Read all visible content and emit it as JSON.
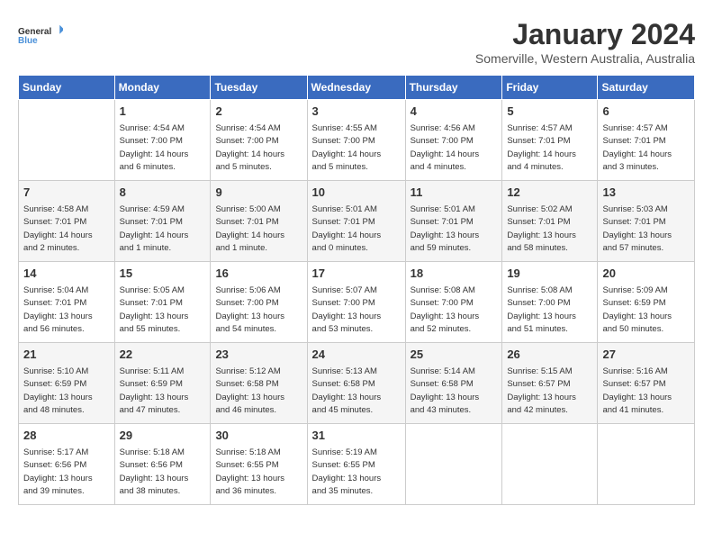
{
  "logo": {
    "line1": "General",
    "line2": "Blue"
  },
  "title": "January 2024",
  "subtitle": "Somerville, Western Australia, Australia",
  "headers": [
    "Sunday",
    "Monday",
    "Tuesday",
    "Wednesday",
    "Thursday",
    "Friday",
    "Saturday"
  ],
  "weeks": [
    [
      {
        "day": "",
        "info": ""
      },
      {
        "day": "1",
        "info": "Sunrise: 4:54 AM\nSunset: 7:00 PM\nDaylight: 14 hours\nand 6 minutes."
      },
      {
        "day": "2",
        "info": "Sunrise: 4:54 AM\nSunset: 7:00 PM\nDaylight: 14 hours\nand 5 minutes."
      },
      {
        "day": "3",
        "info": "Sunrise: 4:55 AM\nSunset: 7:00 PM\nDaylight: 14 hours\nand 5 minutes."
      },
      {
        "day": "4",
        "info": "Sunrise: 4:56 AM\nSunset: 7:00 PM\nDaylight: 14 hours\nand 4 minutes."
      },
      {
        "day": "5",
        "info": "Sunrise: 4:57 AM\nSunset: 7:01 PM\nDaylight: 14 hours\nand 4 minutes."
      },
      {
        "day": "6",
        "info": "Sunrise: 4:57 AM\nSunset: 7:01 PM\nDaylight: 14 hours\nand 3 minutes."
      }
    ],
    [
      {
        "day": "7",
        "info": "Sunrise: 4:58 AM\nSunset: 7:01 PM\nDaylight: 14 hours\nand 2 minutes."
      },
      {
        "day": "8",
        "info": "Sunrise: 4:59 AM\nSunset: 7:01 PM\nDaylight: 14 hours\nand 1 minute."
      },
      {
        "day": "9",
        "info": "Sunrise: 5:00 AM\nSunset: 7:01 PM\nDaylight: 14 hours\nand 1 minute."
      },
      {
        "day": "10",
        "info": "Sunrise: 5:01 AM\nSunset: 7:01 PM\nDaylight: 14 hours\nand 0 minutes."
      },
      {
        "day": "11",
        "info": "Sunrise: 5:01 AM\nSunset: 7:01 PM\nDaylight: 13 hours\nand 59 minutes."
      },
      {
        "day": "12",
        "info": "Sunrise: 5:02 AM\nSunset: 7:01 PM\nDaylight: 13 hours\nand 58 minutes."
      },
      {
        "day": "13",
        "info": "Sunrise: 5:03 AM\nSunset: 7:01 PM\nDaylight: 13 hours\nand 57 minutes."
      }
    ],
    [
      {
        "day": "14",
        "info": "Sunrise: 5:04 AM\nSunset: 7:01 PM\nDaylight: 13 hours\nand 56 minutes."
      },
      {
        "day": "15",
        "info": "Sunrise: 5:05 AM\nSunset: 7:01 PM\nDaylight: 13 hours\nand 55 minutes."
      },
      {
        "day": "16",
        "info": "Sunrise: 5:06 AM\nSunset: 7:00 PM\nDaylight: 13 hours\nand 54 minutes."
      },
      {
        "day": "17",
        "info": "Sunrise: 5:07 AM\nSunset: 7:00 PM\nDaylight: 13 hours\nand 53 minutes."
      },
      {
        "day": "18",
        "info": "Sunrise: 5:08 AM\nSunset: 7:00 PM\nDaylight: 13 hours\nand 52 minutes."
      },
      {
        "day": "19",
        "info": "Sunrise: 5:08 AM\nSunset: 7:00 PM\nDaylight: 13 hours\nand 51 minutes."
      },
      {
        "day": "20",
        "info": "Sunrise: 5:09 AM\nSunset: 6:59 PM\nDaylight: 13 hours\nand 50 minutes."
      }
    ],
    [
      {
        "day": "21",
        "info": "Sunrise: 5:10 AM\nSunset: 6:59 PM\nDaylight: 13 hours\nand 48 minutes."
      },
      {
        "day": "22",
        "info": "Sunrise: 5:11 AM\nSunset: 6:59 PM\nDaylight: 13 hours\nand 47 minutes."
      },
      {
        "day": "23",
        "info": "Sunrise: 5:12 AM\nSunset: 6:58 PM\nDaylight: 13 hours\nand 46 minutes."
      },
      {
        "day": "24",
        "info": "Sunrise: 5:13 AM\nSunset: 6:58 PM\nDaylight: 13 hours\nand 45 minutes."
      },
      {
        "day": "25",
        "info": "Sunrise: 5:14 AM\nSunset: 6:58 PM\nDaylight: 13 hours\nand 43 minutes."
      },
      {
        "day": "26",
        "info": "Sunrise: 5:15 AM\nSunset: 6:57 PM\nDaylight: 13 hours\nand 42 minutes."
      },
      {
        "day": "27",
        "info": "Sunrise: 5:16 AM\nSunset: 6:57 PM\nDaylight: 13 hours\nand 41 minutes."
      }
    ],
    [
      {
        "day": "28",
        "info": "Sunrise: 5:17 AM\nSunset: 6:56 PM\nDaylight: 13 hours\nand 39 minutes."
      },
      {
        "day": "29",
        "info": "Sunrise: 5:18 AM\nSunset: 6:56 PM\nDaylight: 13 hours\nand 38 minutes."
      },
      {
        "day": "30",
        "info": "Sunrise: 5:18 AM\nSunset: 6:55 PM\nDaylight: 13 hours\nand 36 minutes."
      },
      {
        "day": "31",
        "info": "Sunrise: 5:19 AM\nSunset: 6:55 PM\nDaylight: 13 hours\nand 35 minutes."
      },
      {
        "day": "",
        "info": ""
      },
      {
        "day": "",
        "info": ""
      },
      {
        "day": "",
        "info": ""
      }
    ]
  ]
}
